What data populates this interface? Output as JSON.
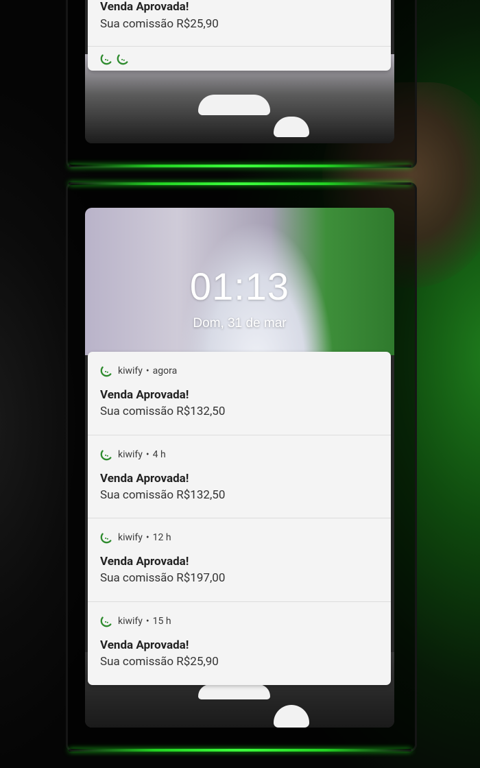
{
  "colors": {
    "accent_green": "#2e8b2e",
    "glow": "#3dff3d",
    "card": "#f4f4f4"
  },
  "lockscreen": {
    "time": "01:13",
    "date": "Dom, 31 de mar"
  },
  "top_notification": {
    "title": "Venda Aprovada!",
    "body": "Sua comissão R$25,90",
    "icons": [
      "kiwify-icon",
      "kiwify-icon"
    ]
  },
  "notifications": [
    {
      "app": "kiwify",
      "sep": "•",
      "time": "agora",
      "title": "Venda Aprovada!",
      "body": "Sua comissão R$132,50"
    },
    {
      "app": "kiwify",
      "sep": "•",
      "time": "4 h",
      "title": "Venda Aprovada!",
      "body": "Sua comissão R$132,50"
    },
    {
      "app": "kiwify",
      "sep": "•",
      "time": "12 h",
      "title": "Venda Aprovada!",
      "body": "Sua comissão R$197,00"
    },
    {
      "app": "kiwify",
      "sep": "•",
      "time": "15 h",
      "title": "Venda Aprovada!",
      "body": "Sua comissão R$25,90"
    }
  ]
}
